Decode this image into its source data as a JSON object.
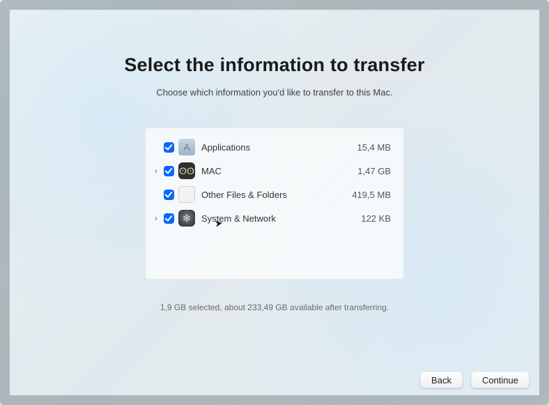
{
  "title": "Select the information to transfer",
  "subtitle": "Choose which information you'd like to transfer to this Mac.",
  "items": [
    {
      "icon": "folder",
      "label": "Applications",
      "size": "15,4 MB",
      "expandable": false
    },
    {
      "icon": "owl",
      "label": "MAC",
      "size": "1,47 GB",
      "expandable": true
    },
    {
      "icon": "file",
      "label": "Other Files & Folders",
      "size": "419,5 MB",
      "expandable": false
    },
    {
      "icon": "gear",
      "label": "System & Network",
      "size": "122 KB",
      "expandable": true
    }
  ],
  "status": "1,9 GB selected, about 233,49 GB available after transferring.",
  "buttons": {
    "back": "Back",
    "continue": "Continue"
  }
}
